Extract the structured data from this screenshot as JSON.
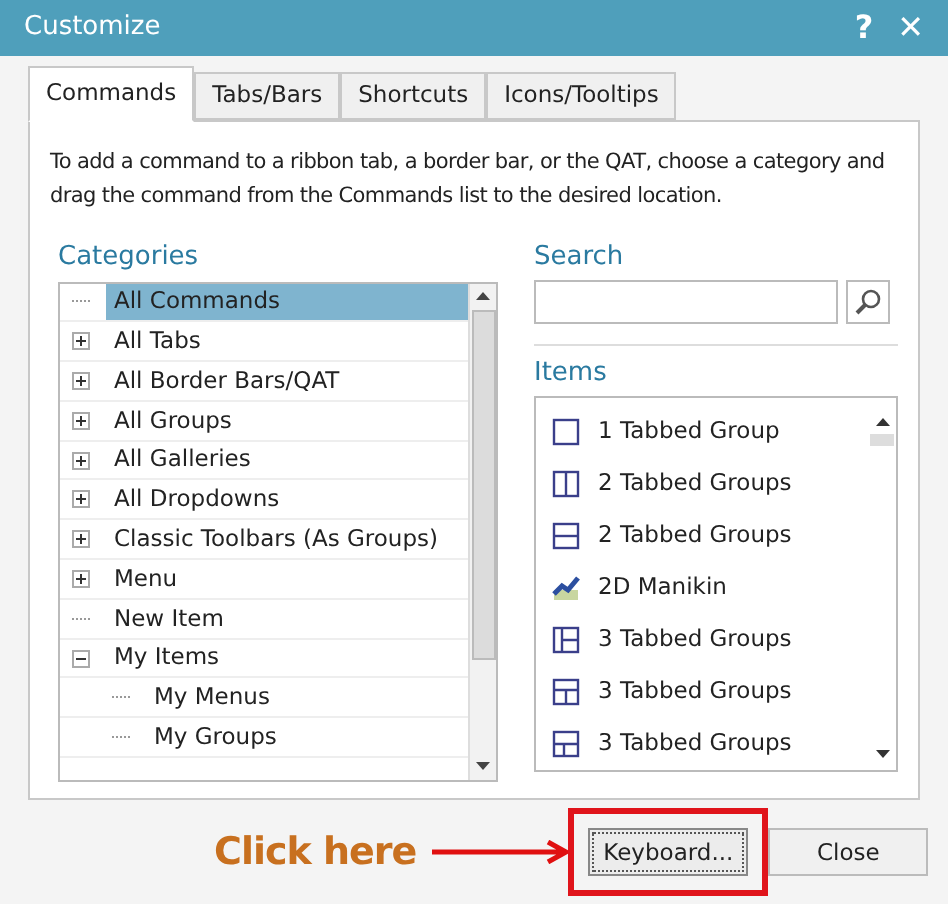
{
  "window": {
    "title": "Customize",
    "help": "?",
    "close": "✕"
  },
  "tabs": [
    {
      "label": "Commands",
      "selected": true
    },
    {
      "label": "Tabs/Bars",
      "selected": false
    },
    {
      "label": "Shortcuts",
      "selected": false
    },
    {
      "label": "Icons/Tooltips",
      "selected": false
    }
  ],
  "instructions": "To add a command to a ribbon tab, a border bar, or the QAT, choose a category and drag the command from the Commands list to the desired location.",
  "categories": {
    "label": "Categories",
    "items": [
      {
        "label": "All Commands",
        "selected": true
      },
      {
        "label": "All Tabs",
        "selected": false,
        "expanded": false
      },
      {
        "label": "All Border Bars/QAT",
        "selected": false,
        "expanded": false
      },
      {
        "label": "All Groups",
        "selected": false,
        "expanded": false
      },
      {
        "label": "All Galleries",
        "selected": false,
        "expanded": false
      },
      {
        "label": "All Dropdowns",
        "selected": false,
        "expanded": false
      },
      {
        "label": "Classic Toolbars (As Groups)",
        "selected": false,
        "expanded": false
      },
      {
        "label": "Menu",
        "selected": false,
        "expanded": false
      },
      {
        "label": "New Item",
        "selected": false
      },
      {
        "label": "My Items",
        "selected": false,
        "expanded": true,
        "children": [
          {
            "label": "My Menus",
            "selected": false
          },
          {
            "label": "My Groups",
            "selected": false
          }
        ]
      }
    ]
  },
  "search": {
    "label": "Search"
  },
  "items": {
    "label": "Items",
    "list": [
      {
        "label": "1 Tabbed Group",
        "kind": "single"
      },
      {
        "label": "2 Tabbed Groups",
        "kind": "vsplit"
      },
      {
        "label": "2 Tabbed Groups",
        "kind": "hsplit"
      },
      {
        "label": "2D Manikin",
        "kind": "manikin"
      },
      {
        "label": "3 Tabbed Groups",
        "kind": "leftright"
      },
      {
        "label": "3 Tabbed Groups",
        "kind": "topbottom"
      },
      {
        "label": "3 Tabbed Groups",
        "kind": "bottomtop"
      }
    ]
  },
  "annotation": "Click here",
  "buttons": [
    {
      "label": "Keyboard...",
      "highlighted": true
    },
    {
      "label": "Close",
      "highlighted": false
    }
  ]
}
